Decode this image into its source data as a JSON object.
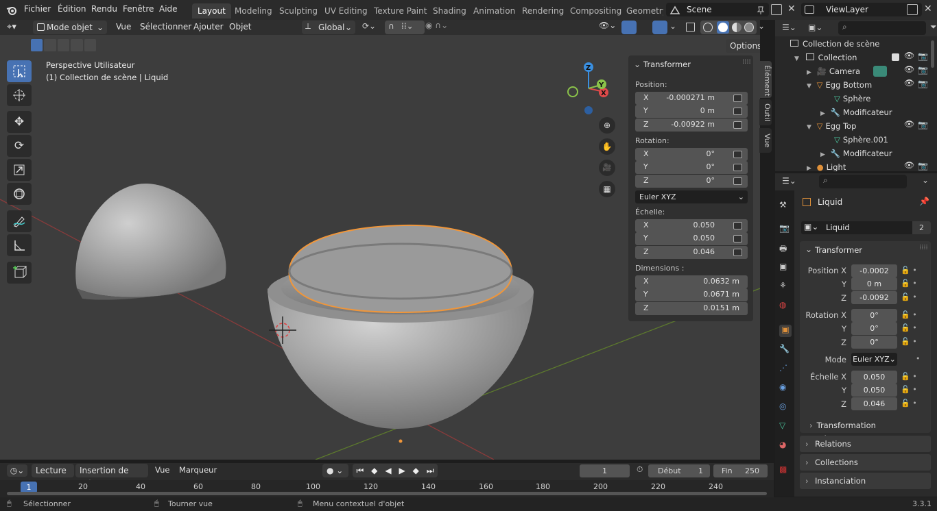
{
  "menu": {
    "items": [
      "Fichier",
      "Édition",
      "Rendu",
      "Fenêtre",
      "Aide"
    ]
  },
  "workspaces": {
    "tabs": [
      "Layout",
      "Modeling",
      "Sculpting",
      "UV Editing",
      "Texture Paint",
      "Shading",
      "Animation",
      "Rendering",
      "Compositing",
      "Geometry"
    ]
  },
  "scene": {
    "name": "Scene"
  },
  "viewlayer": {
    "name": "ViewLayer"
  },
  "header3d": {
    "mode": "Mode objet",
    "menus": [
      "Vue",
      "Sélectionner",
      "Ajouter",
      "Objet"
    ],
    "orientation": "Global",
    "options": "Options"
  },
  "viewport": {
    "view_name": "Perspective Utilisateur",
    "context": "(1) Collection de scène | Liquid"
  },
  "npanel": {
    "title": "Transformer",
    "position_label": "Position:",
    "position": [
      {
        "axis": "X",
        "value": "-0.000271 m"
      },
      {
        "axis": "Y",
        "value": "0 m"
      },
      {
        "axis": "Z",
        "value": "-0.00922 m"
      }
    ],
    "rotation_label": "Rotation:",
    "rotation": [
      {
        "axis": "X",
        "value": "0°"
      },
      {
        "axis": "Y",
        "value": "0°"
      },
      {
        "axis": "Z",
        "value": "0°"
      }
    ],
    "rotation_mode": "Euler XYZ",
    "scale_label": "Échelle:",
    "scale": [
      {
        "axis": "X",
        "value": "0.050"
      },
      {
        "axis": "Y",
        "value": "0.050"
      },
      {
        "axis": "Z",
        "value": "0.046"
      }
    ],
    "dimensions_label": "Dimensions :",
    "dimensions": [
      {
        "axis": "X",
        "value": "0.0632 m"
      },
      {
        "axis": "Y",
        "value": "0.0671 m"
      },
      {
        "axis": "Z",
        "value": "0.0151 m"
      }
    ],
    "tabs": [
      "Élément",
      "Outil",
      "Vue"
    ]
  },
  "outliner": {
    "root": "Collection de scène",
    "items": [
      {
        "label": "Collection",
        "depth": 1
      },
      {
        "label": "Camera",
        "depth": 2
      },
      {
        "label": "Egg Bottom",
        "depth": 2
      },
      {
        "label": "Sphère",
        "depth": 3
      },
      {
        "label": "Modificateur",
        "depth": 3
      },
      {
        "label": "Egg Top",
        "depth": 2
      },
      {
        "label": "Sphère.001",
        "depth": 3
      },
      {
        "label": "Modificateur",
        "depth": 3
      },
      {
        "label": "Light",
        "depth": 2
      }
    ]
  },
  "properties": {
    "object_name": "Liquid",
    "data_name": "Liquid",
    "users": "2",
    "section_transform": "Transformer",
    "position_label": "Position X",
    "position": [
      "-0.0002",
      "0 m",
      "-0.0092"
    ],
    "rotation_label": "Rotation X",
    "rotation": [
      "0°",
      "0°",
      "0°"
    ],
    "mode_label": "Mode",
    "mode": "Euler XYZ",
    "scale_label": "Échelle X",
    "scale": [
      "0.050",
      "0.050",
      "0.046"
    ],
    "axis_y": "Y",
    "axis_z": "Z",
    "delta": "Transformation différentielle",
    "sections": [
      "Relations",
      "Collections",
      "Instanciation"
    ]
  },
  "timeline": {
    "menus": [
      "Lecture",
      "Insertion de clés",
      "Vue",
      "Marqueur"
    ],
    "current_frame": "1",
    "start_label": "Début",
    "start": "1",
    "end_label": "Fin",
    "end": "250",
    "ticks": [
      "1",
      "20",
      "40",
      "60",
      "80",
      "100",
      "120",
      "140",
      "160",
      "180",
      "200",
      "220",
      "240"
    ]
  },
  "status": {
    "select": "Sélectionner",
    "rotate": "Tourner vue",
    "context_menu": "Menu contextuel d'objet",
    "version": "3.3.1"
  }
}
